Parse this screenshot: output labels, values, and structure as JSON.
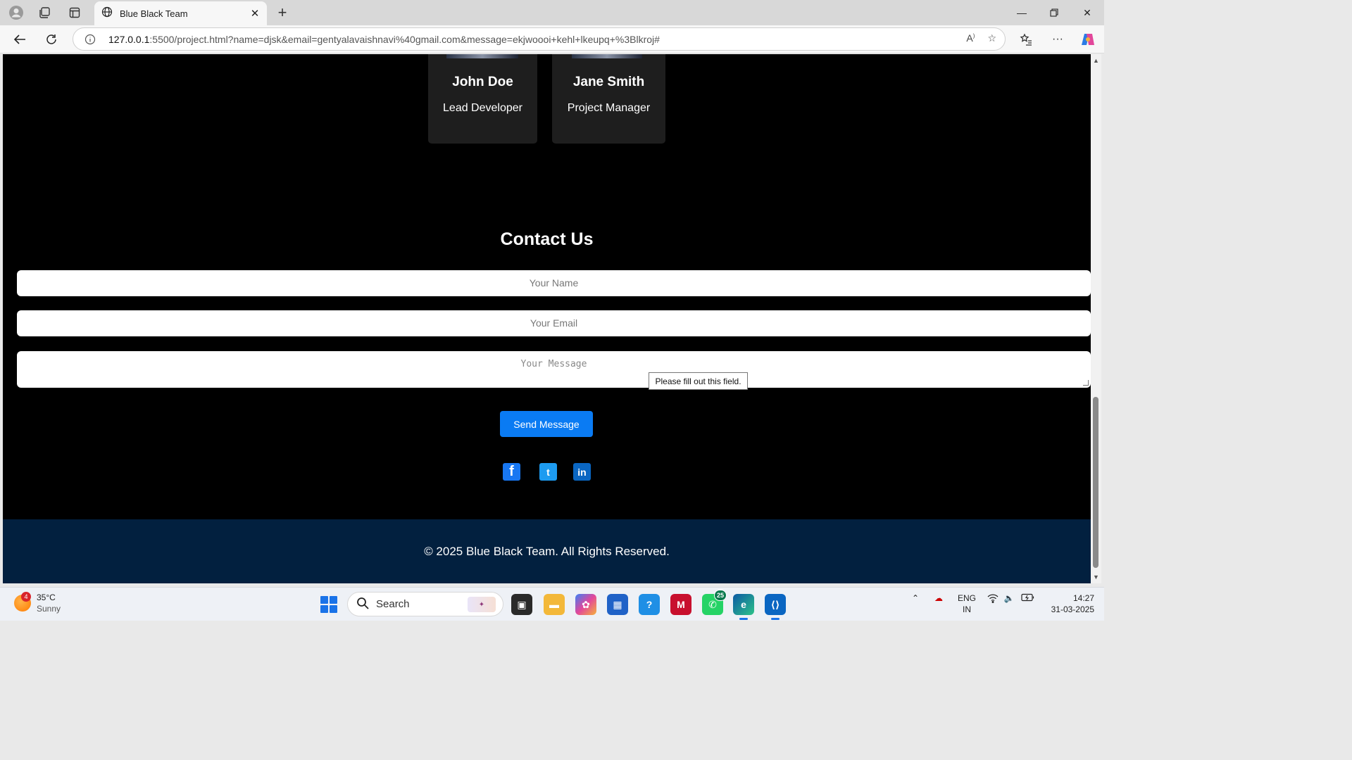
{
  "browser": {
    "tab_title": "Blue Black Team",
    "url_host": "127.0.0.1",
    "url_rest": ":5500/project.html?name=djsk&email=gentyalavaishnavi%40gmail.com&message=ekjwoooi+kehl+lkeupq+%3Blkroj#"
  },
  "team": {
    "members": [
      {
        "name": "John Doe",
        "role": "Lead Developer"
      },
      {
        "name": "Jane Smith",
        "role": "Project Manager"
      }
    ]
  },
  "contact": {
    "title": "Contact Us",
    "name_placeholder": "Your Name",
    "email_placeholder": "Your Email",
    "message_placeholder": "Your Message",
    "validation_tooltip": "Please fill out this field.",
    "send_label": "Send Message"
  },
  "social": {
    "facebook": "f",
    "twitter": "t",
    "linkedin": "in"
  },
  "footer": {
    "copyright": "© 2025 Blue Black Team. All Rights Reserved."
  },
  "taskbar": {
    "weather_temp": "35°C",
    "weather_desc": "Sunny",
    "weather_badge": "4",
    "search_label": "Search",
    "whatsapp_count": "25",
    "lang_top": "ENG",
    "lang_bottom": "IN",
    "time": "14:27",
    "date": "31-03-2025"
  },
  "colors": {
    "accent": "#0a7bf3",
    "footer_bg": "#02203f",
    "card_bg": "#1e1e1e"
  }
}
